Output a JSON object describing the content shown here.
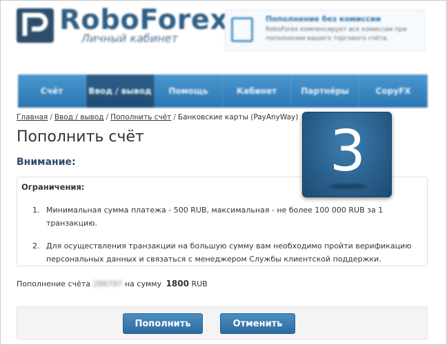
{
  "header": {
    "logo_title": "RoboForex",
    "logo_subtitle": "Личный кабинет",
    "promo_title": "Пополнение без комиссии",
    "promo_text": "RoboForex компенсирует все комиссии при пополнении вашего торгового счёта."
  },
  "nav": {
    "items": [
      {
        "label": "Счёт"
      },
      {
        "label": "Ввод / вывод"
      },
      {
        "label": "Помощь"
      },
      {
        "label": "Кабинет"
      },
      {
        "label": "Партнёры"
      },
      {
        "label": "CopyFX"
      }
    ],
    "active_index": 1
  },
  "breadcrumb": {
    "items": [
      "Главная",
      "Ввод / вывод",
      "Пополнить счёт"
    ],
    "current": "Банковские карты (PayAnyWay)",
    "separator": "/"
  },
  "page_title": "Пополнить счёт",
  "attention_label": "Внимание:",
  "restrictions": {
    "title": "Ограничения:",
    "items": [
      {
        "num": "1.",
        "text": "Минимальная сумма платежа - 500 RUB, максимальная - не более 100 000 RUB за 1 транзакцию."
      },
      {
        "num": "2.",
        "text": "Для осуществления транзакции на большую сумму вам необходимо пройти верификацию персональных данных и связаться с менеджером Службы клиентской поддержки."
      }
    ]
  },
  "summary": {
    "prefix": "Пополнение счёта",
    "account": "286797",
    "middle": "на сумму",
    "amount": "1800",
    "currency": "RUB"
  },
  "buttons": {
    "submit_label": "Пополнить",
    "cancel_label": "Отменить"
  },
  "step_badge": {
    "number": "3"
  },
  "colors": {
    "brand_blue": "#2f5f86",
    "nav_blue": "#3a86c0",
    "button_blue": "#3b7db0",
    "badge_blue": "#2a618e"
  }
}
